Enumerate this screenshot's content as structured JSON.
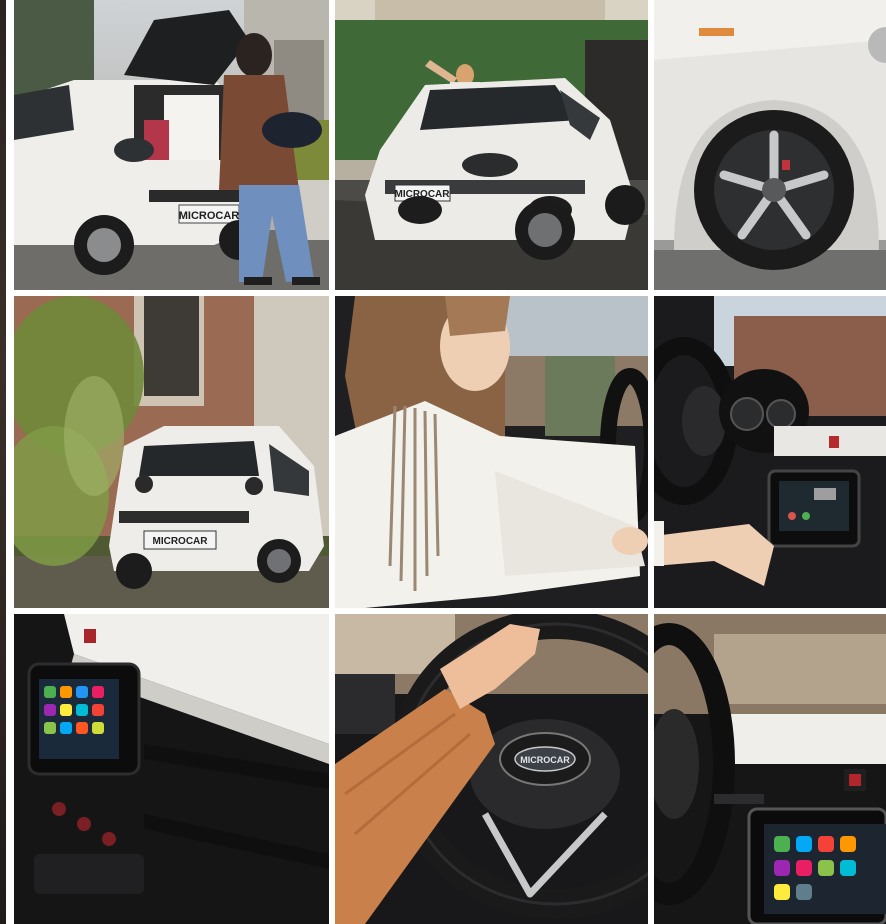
{
  "gallery": {
    "tiles": [
      {
        "id": "white-microcar-rear-open-trunk",
        "plate": "MICROCAR"
      },
      {
        "id": "white-microcar-front-woman-waving",
        "plate": "MICROCAR"
      },
      {
        "id": "microcar-wheel-closeup"
      },
      {
        "id": "white-microcar-rear-brick-building",
        "plate": "MICROCAR"
      },
      {
        "id": "woman-driving-microcar"
      },
      {
        "id": "hand-on-dashboard-screen"
      },
      {
        "id": "dashboard-infotainment-screen"
      },
      {
        "id": "hand-on-steering-wheel",
        "badge": "MICROCAR"
      },
      {
        "id": "steering-wheel-and-carplay-screen"
      }
    ]
  },
  "colors": {
    "car_white": "#ecebe8",
    "dashboard_black": "#1b1b1d",
    "sweater_orange": "#c9804a",
    "brick": "#9a6a52",
    "grass": "#6f7a3c"
  }
}
